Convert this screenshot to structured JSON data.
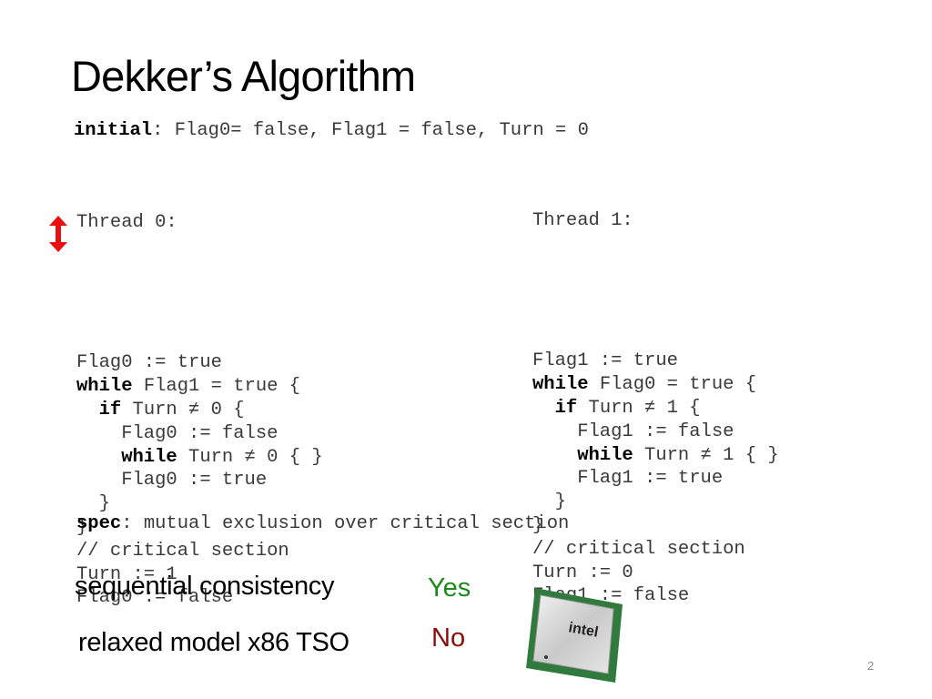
{
  "slide": {
    "title": "Dekker’s Algorithm",
    "page_number": "2"
  },
  "initial": {
    "keyword": "initial",
    "colon": ":",
    "text": " Flag0= false, Flag1 = false, Turn = 0"
  },
  "thread0": {
    "header": "Thread 0:",
    "lines": [
      {
        "kw": "",
        "text": "Flag0 := true"
      },
      {
        "kw": "while",
        "text": " Flag1 = true {"
      },
      {
        "kw": "  if",
        "text": " Turn ≠ 0 {"
      },
      {
        "kw": "",
        "text": "    Flag0 := false"
      },
      {
        "kw": "    while",
        "text": " Turn ≠ 0 { }"
      },
      {
        "kw": "",
        "text": "    Flag0 := true"
      },
      {
        "kw": "",
        "text": "  }"
      },
      {
        "kw": "",
        "text": "}"
      },
      {
        "kw": "",
        "text": "// critical section"
      },
      {
        "kw": "",
        "text": "Turn := 1"
      },
      {
        "kw": "",
        "text": "Flag0 := false"
      }
    ]
  },
  "thread1": {
    "header": "Thread 1:",
    "lines": [
      {
        "kw": "",
        "text": "Flag1 := true"
      },
      {
        "kw": "while",
        "text": " Flag0 = true {"
      },
      {
        "kw": "  if",
        "text": " Turn ≠ 1 {"
      },
      {
        "kw": "",
        "text": "    Flag1 := false"
      },
      {
        "kw": "    while",
        "text": " Turn ≠ 1 { }"
      },
      {
        "kw": "",
        "text": "    Flag1 := true"
      },
      {
        "kw": "",
        "text": "  }"
      },
      {
        "kw": "",
        "text": "}"
      },
      {
        "kw": "",
        "text": "// critical section"
      },
      {
        "kw": "",
        "text": "Turn := 0"
      },
      {
        "kw": "",
        "text": "Flag1 := false"
      }
    ]
  },
  "spec": {
    "keyword": "spec",
    "colon": ":",
    "text": " mutual exclusion over critical section"
  },
  "models": [
    {
      "label": "sequential consistency",
      "result": "Yes",
      "color": "#1a8a1a"
    },
    {
      "label": "relaxed model x86 TSO",
      "result": "No",
      "color": "#8b0a0a"
    }
  ],
  "arrow": {
    "icon": "double-arrow-vertical-icon",
    "color": "#e81010"
  },
  "chip": {
    "icon": "intel-cpu-icon",
    "brand_text": "intel"
  }
}
